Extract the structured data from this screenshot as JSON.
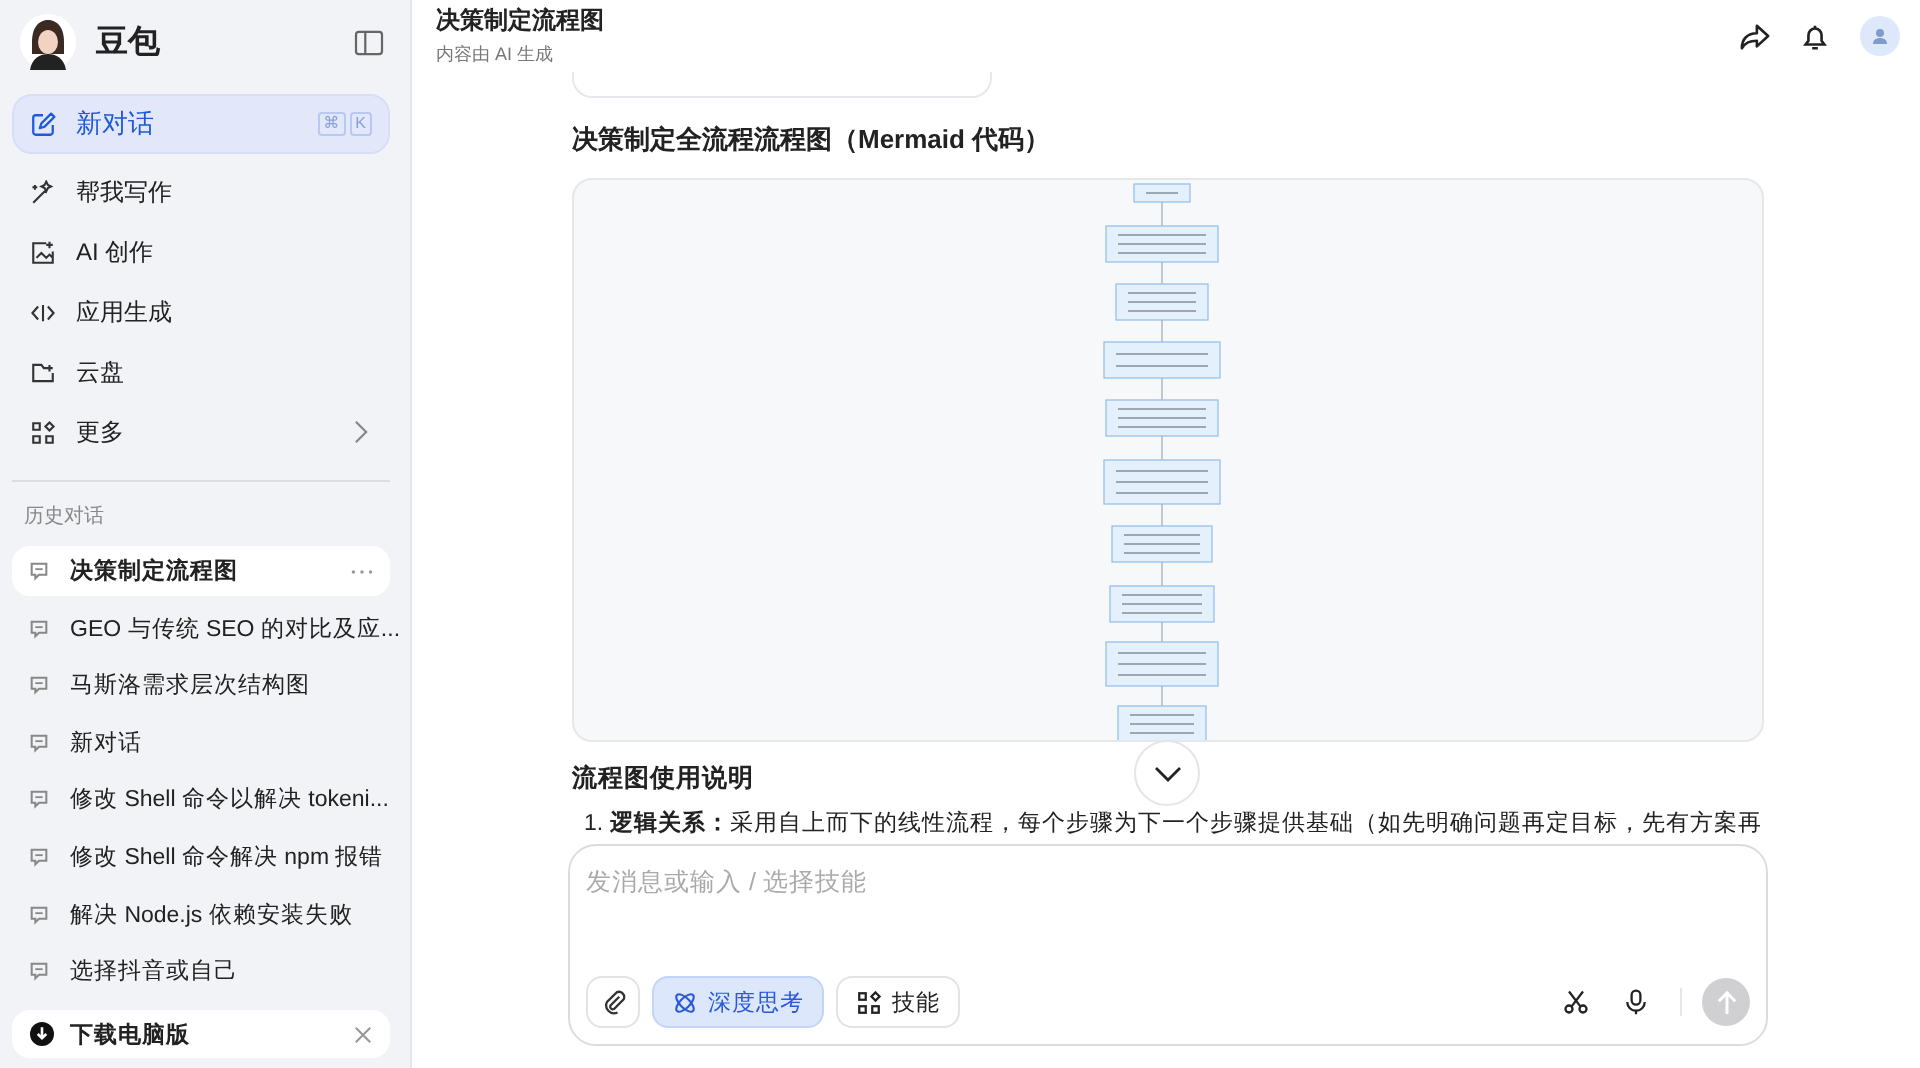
{
  "sidebar": {
    "app_name": "豆包",
    "primary": {
      "label": "新对话",
      "shortcut": [
        "⌘",
        "K"
      ],
      "selected": true
    },
    "menu": [
      {
        "label": "帮我写作",
        "has_arrow": false
      },
      {
        "label": "AI 创作",
        "has_arrow": false
      },
      {
        "label": "应用生成",
        "has_arrow": false
      },
      {
        "label": "云盘",
        "has_arrow": false
      },
      {
        "label": "更多",
        "has_arrow": true
      }
    ],
    "history_heading": "历史对话",
    "history": [
      {
        "title": "决策制定流程图",
        "selected": true
      },
      {
        "title": "GEO 与传统 SEO 的对比及应...",
        "selected": false
      },
      {
        "title": "马斯洛需求层次结构图",
        "selected": false
      },
      {
        "title": "新对话",
        "selected": false
      },
      {
        "title": "修改 Shell 命令以解决 tokeni...",
        "selected": false
      },
      {
        "title": "修改 Shell 命令解决 npm 报错",
        "selected": false
      },
      {
        "title": "解决 Node.js 依赖安装失败",
        "selected": false
      },
      {
        "title": "选择抖音或自己",
        "selected": false
      }
    ],
    "download_banner": {
      "label": "下载电脑版"
    }
  },
  "header": {
    "title": "决策制定流程图",
    "subtitle": "内容由 AI 生成"
  },
  "content": {
    "heading": "决策制定全流程流程图（Mermaid 代码）",
    "diagram": {
      "kind": "picture"
    },
    "section_heading": "流程图使用说明",
    "paragraph": "1. **逻辑关系：**采用自上而下的线性流程，每个步骤为下一个步骤提供基础（如先明确问题再定目标，先有方案再"
  },
  "composer": {
    "placeholder": "发消息或输入 / 选择技能",
    "tools": [
      {
        "label": "深度思考",
        "selected": true
      },
      {
        "label": "技能",
        "selected": false
      }
    ]
  }
}
